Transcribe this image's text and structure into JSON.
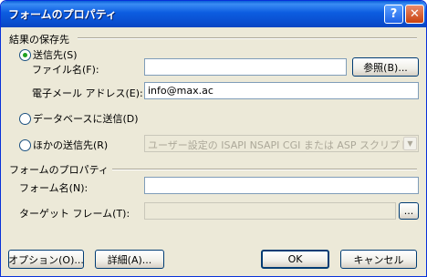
{
  "window": {
    "title": "フォームのプロパティ"
  },
  "titlebar": {
    "help_glyph": "?",
    "close_glyph": "✕"
  },
  "save_section": {
    "label": "結果の保存先",
    "send_to": {
      "label": "送信先(S)",
      "selected": true,
      "file_name_label": "ファイル名(F):",
      "file_name_value": "",
      "browse_button": "参照(B)...",
      "email_label": "電子メール アドレス(E):",
      "email_value": "info@max.ac"
    },
    "send_to_database": {
      "label": "データベースに送信(D)",
      "selected": false
    },
    "other_send_to": {
      "label": "ほかの送信先(R)",
      "selected": false,
      "select_value": "ユーザー設定の ISAPI NSAPI CGI または ASP スクリプト"
    }
  },
  "form_props_section": {
    "label": "フォームのプロパティ",
    "form_name_label": "フォーム名(N):",
    "form_name_value": "",
    "target_frame_label": "ターゲット フレーム(T):",
    "target_frame_value": "",
    "target_frame_button": "..."
  },
  "footer": {
    "options_button": "オプション(O)...",
    "advanced_button": "詳細(A)...",
    "ok_button": "OK",
    "cancel_button": "キャンセル"
  },
  "colors": {
    "titlebar": "#0a5fd8",
    "dialog_bg": "#ece9d8",
    "radio_dot": "#21a121"
  },
  "icons": {
    "help": "help-icon",
    "close": "close-icon",
    "pencil": "pencil-icon",
    "dropdown": "chevron-down-icon"
  }
}
